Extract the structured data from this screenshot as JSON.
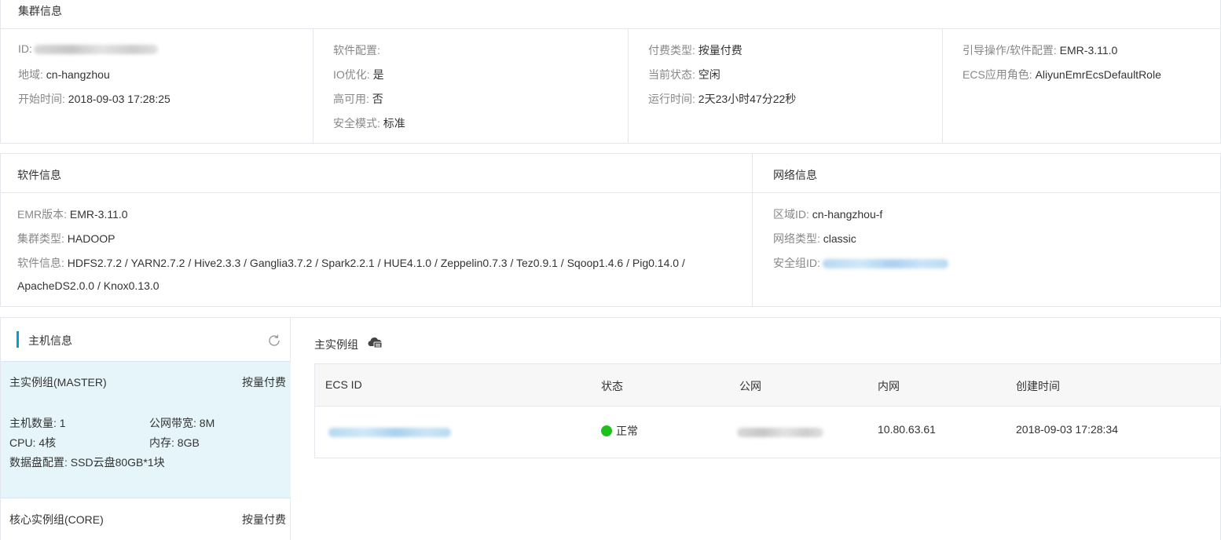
{
  "cluster_info": {
    "title": "集群信息",
    "col1": [
      {
        "label": "ID:",
        "value": ""
      },
      {
        "label": "地域:",
        "value": "cn-hangzhou"
      },
      {
        "label": "开始时间:",
        "value": "2018-09-03 17:28:25"
      }
    ],
    "col2": [
      {
        "label": "软件配置:",
        "value": ""
      },
      {
        "label": "IO优化:",
        "value": "是"
      },
      {
        "label": "高可用:",
        "value": "否"
      },
      {
        "label": "安全模式:",
        "value": "标准"
      }
    ],
    "col3": [
      {
        "label": "付费类型:",
        "value": "按量付费"
      },
      {
        "label": "当前状态:",
        "value": "空闲"
      },
      {
        "label": "运行时间:",
        "value": "2天23小时47分22秒"
      }
    ],
    "col4": [
      {
        "label": "引导操作/软件配置:",
        "value": "EMR-3.11.0"
      },
      {
        "label": "ECS应用角色:",
        "value": "AliyunEmrEcsDefaultRole"
      }
    ]
  },
  "software_info": {
    "title": "软件信息",
    "rows": [
      {
        "label": "EMR版本:",
        "value": "EMR-3.11.0"
      },
      {
        "label": "集群类型:",
        "value": "HADOOP"
      },
      {
        "label": "软件信息:",
        "value": "HDFS2.7.2 / YARN2.7.2 / Hive2.3.3 / Ganglia3.7.2 / Spark2.2.1 / HUE4.1.0 / Zeppelin0.7.3 / Tez0.9.1 / Sqoop1.4.6 / Pig0.14.0 /"
      }
    ],
    "continuation": "ApacheDS2.0.0 / Knox0.13.0"
  },
  "network_info": {
    "title": "网络信息",
    "rows": [
      {
        "label": "区域ID:",
        "value": "cn-hangzhou-f"
      },
      {
        "label": "网络类型:",
        "value": "classic"
      },
      {
        "label": "安全组ID:",
        "value": ""
      }
    ]
  },
  "host_info": {
    "title": "主机信息",
    "icons": {
      "refresh": "refresh-icon",
      "cloud": "cloud-icon"
    },
    "groups": [
      {
        "name": "主实例组(MASTER)",
        "billing": "按量付费",
        "host_count": "主机数量: 1",
        "bandwidth": "公网带宽: 8M",
        "cpu": "CPU: 4核",
        "memory": "内存: 8GB",
        "disk": "数据盘配置: SSD云盘80GB*1块"
      },
      {
        "name": "核心实例组(CORE)",
        "billing": "按量付费"
      }
    ],
    "selected_group_title": "主实例组",
    "table": {
      "columns": [
        "ECS ID",
        "状态",
        "公网",
        "内网",
        "创建时间"
      ],
      "rows": [
        {
          "ecs_id": "",
          "status": "正常",
          "public_ip": "",
          "private_ip": "10.80.63.61",
          "created": "2018-09-03 17:28:34"
        }
      ]
    }
  },
  "colors": {
    "accent": "#00a2ca",
    "selected_bg": "#e6f5f9",
    "status_ok": "#1dc11d",
    "border": "#e4e7ec",
    "label": "#888888"
  }
}
